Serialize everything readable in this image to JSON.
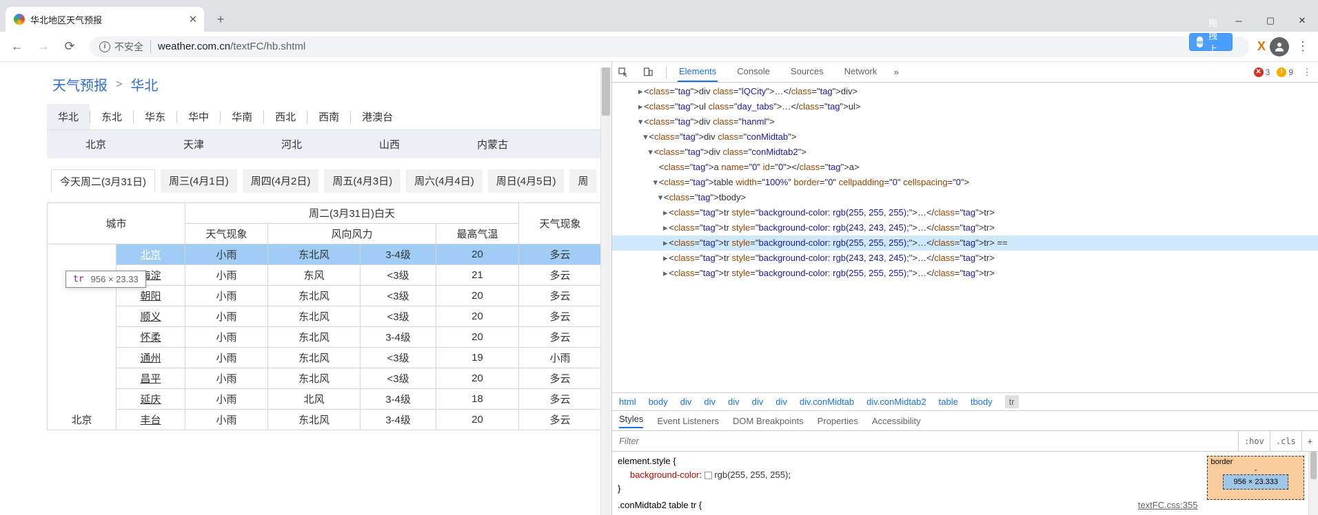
{
  "browser": {
    "tab_title": "华北地区天气预报",
    "insecure_label": "不安全",
    "url_domain": "weather.com.cn",
    "url_path": "/textFC/hb.shtml",
    "upload_label": "拖拽上传",
    "ext_x": "X"
  },
  "breadcrumb": {
    "a": "天气预报",
    "sep": ">",
    "b": "华北"
  },
  "region_tabs": [
    "华北",
    "东北",
    "华东",
    "华中",
    "华南",
    "西北",
    "西南",
    "港澳台"
  ],
  "prov_tabs": [
    "北京",
    "天津",
    "河北",
    "山西",
    "内蒙古"
  ],
  "day_tabs": [
    "今天周二(3月31日)",
    "周三(4月1日)",
    "周四(4月2日)",
    "周五(4月3日)",
    "周六(4月4日)",
    "周日(4月5日)",
    "周"
  ],
  "tooltip": {
    "tag": "tr",
    "dim": "956 × 23.33"
  },
  "table": {
    "head1": {
      "city": "城市",
      "day": "周二(3月31日)白天"
    },
    "head2": [
      "天气现象",
      "风向风力",
      "最高气温",
      "天气现象"
    ],
    "prov_cell": "北京",
    "rows": [
      {
        "hl": true,
        "city": "北京",
        "w": "小雨",
        "wd": "东北风",
        "wp": "3-4级",
        "t": "20",
        "n": "多云"
      },
      {
        "hl": false,
        "city": "海淀",
        "w": "小雨",
        "wd": "东风",
        "wp": "<3级",
        "t": "21",
        "n": "多云"
      },
      {
        "hl": false,
        "city": "朝阳",
        "w": "小雨",
        "wd": "东北风",
        "wp": "<3级",
        "t": "20",
        "n": "多云"
      },
      {
        "hl": false,
        "city": "顺义",
        "w": "小雨",
        "wd": "东北风",
        "wp": "<3级",
        "t": "20",
        "n": "多云"
      },
      {
        "hl": false,
        "city": "怀柔",
        "w": "小雨",
        "wd": "东北风",
        "wp": "3-4级",
        "t": "20",
        "n": "多云"
      },
      {
        "hl": false,
        "city": "通州",
        "w": "小雨",
        "wd": "东北风",
        "wp": "<3级",
        "t": "19",
        "n": "小雨"
      },
      {
        "hl": false,
        "city": "昌平",
        "w": "小雨",
        "wd": "东北风",
        "wp": "<3级",
        "t": "20",
        "n": "多云"
      },
      {
        "hl": false,
        "city": "延庆",
        "w": "小雨",
        "wd": "北风",
        "wp": "3-4级",
        "t": "18",
        "n": "多云"
      },
      {
        "hl": false,
        "city": "丰台",
        "w": "小雨",
        "wd": "东北风",
        "wp": "3-4级",
        "t": "20",
        "n": "多云"
      }
    ]
  },
  "devtools": {
    "tabs": [
      "Elements",
      "Console",
      "Sources",
      "Network"
    ],
    "err_count": "3",
    "warn_count": "9",
    "el_lines": [
      {
        "ind": 72,
        "tri": "▸",
        "txt": "<div class=\"lQCity\">…</div>"
      },
      {
        "ind": 72,
        "tri": "▸",
        "txt": "<ul class=\"day_tabs\">…</ul>"
      },
      {
        "ind": 72,
        "tri": "▾",
        "txt": "<div class=\"hanml\">"
      },
      {
        "ind": 86,
        "tri": "▾",
        "txt": "<div class=\"conMidtab\">"
      },
      {
        "ind": 100,
        "tri": "▾",
        "txt": "<div class=\"conMidtab2\">"
      },
      {
        "ind": 116,
        "tri": " ",
        "txt": "<a name=\"0\" id=\"0\"></a>"
      },
      {
        "ind": 114,
        "tri": "▾",
        "txt": "<table width=\"100%\" border=\"0\" cellpadding=\"0\" cellspacing=\"0\">"
      },
      {
        "ind": 128,
        "tri": "▾",
        "txt": "<tbody>"
      },
      {
        "ind": 142,
        "tri": "▸",
        "txt": "<tr style=\"background-color: rgb(255, 255, 255);\">…</tr>"
      },
      {
        "ind": 142,
        "tri": "▸",
        "txt": "<tr style=\"background-color: rgb(243, 243, 245);\">…</tr>"
      },
      {
        "ind": 142,
        "tri": "▸",
        "sel": true,
        "txt": "<tr style=\"background-color: rgb(255, 255, 255);\">…</tr> == "
      },
      {
        "ind": 142,
        "tri": "▸",
        "txt": "<tr style=\"background-color: rgb(243, 243, 245);\">…</tr>"
      },
      {
        "ind": 142,
        "tri": "▸",
        "txt": "<tr style=\"background-color: rgb(255, 255, 255);\">…</tr>"
      }
    ],
    "bc": [
      "html",
      "body",
      "div",
      "div",
      "div",
      "div",
      "div",
      "div.conMidtab",
      "div.conMidtab2",
      "table",
      "tbody",
      "tr"
    ],
    "styles_tabs": [
      "Styles",
      "Event Listeners",
      "DOM Breakpoints",
      "Properties",
      "Accessibility"
    ],
    "filter_ph": "Filter",
    "hov": ":hov",
    "cls": ".cls",
    "rule1_sel": "element.style {",
    "rule1_prop": "background-color",
    "rule1_val": "rgb(255, 255, 255)",
    "rule1_close": "}",
    "rule2_sel": ".conMidtab2 table tr {",
    "rule2_src": "textFC.css:355",
    "bm_outer": "border",
    "bm_dash": "-",
    "bm_inner": "956 × 23.333"
  }
}
